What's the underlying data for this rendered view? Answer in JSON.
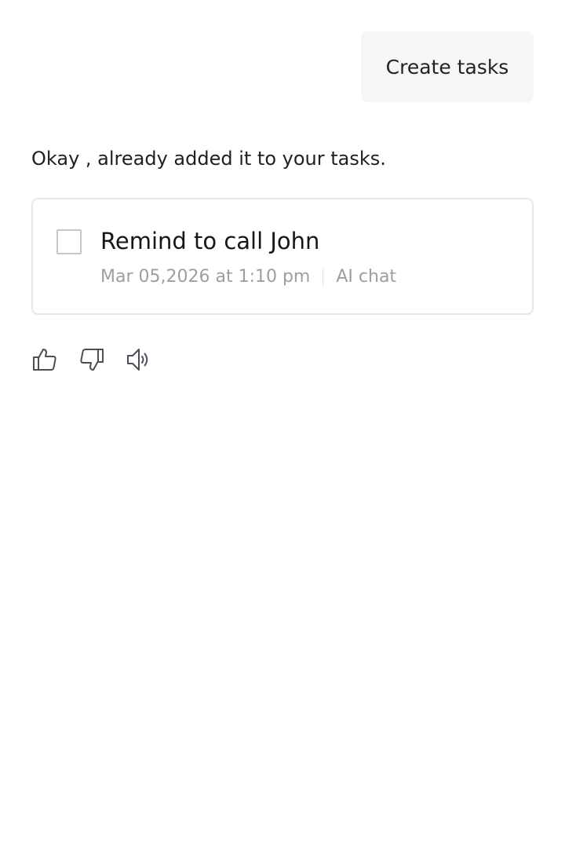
{
  "chat": {
    "user_message": "Create tasks",
    "assistant_message": "Okay , already added it to your tasks."
  },
  "task": {
    "title": "Remind to call John",
    "datetime": "Mar 05,2026 at 1:10 pm",
    "source": "AI chat",
    "completed": false
  },
  "feedback": {
    "icons": [
      "thumbs-up-icon",
      "thumbs-down-icon",
      "speaker-icon"
    ]
  },
  "colors": {
    "bubble_bg": "#f6f6f6",
    "card_border": "#e8e8e8",
    "meta_text": "#9a9fa6",
    "icon_stroke": "#4a4f57"
  }
}
